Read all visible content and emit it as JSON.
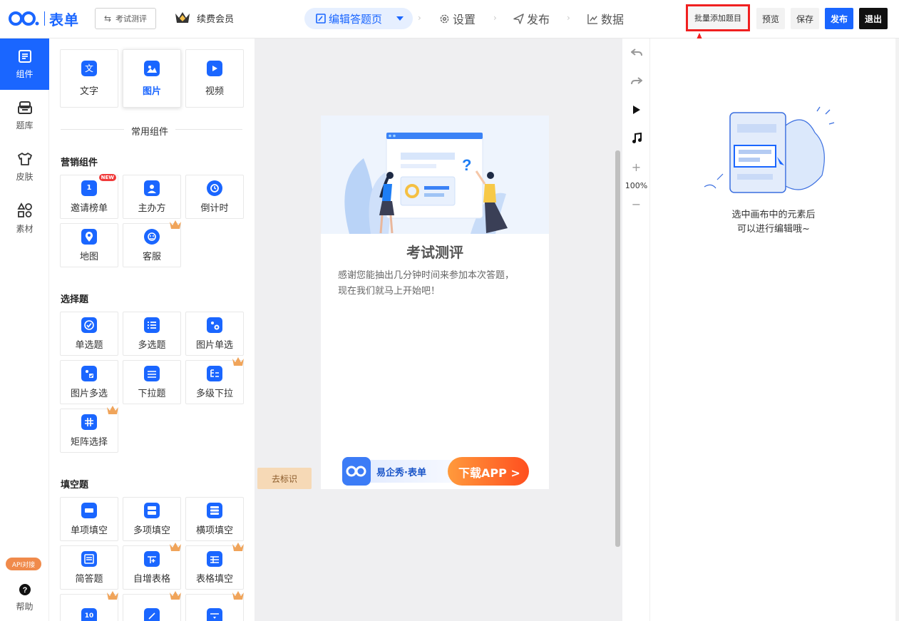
{
  "app": {
    "logo_text": "表单"
  },
  "header": {
    "form_title": "考试测评",
    "vip_label": "续费会员",
    "nav_active": "编辑答题页",
    "nav_settings": "设置",
    "nav_publish": "发布",
    "nav_data": "数据",
    "batch_add": "批量添加题目",
    "preview": "预览",
    "save": "保存",
    "publish_btn": "发布",
    "exit": "退出"
  },
  "rail": {
    "components": "组件",
    "bank": "题库",
    "skin": "皮肤",
    "material": "素材",
    "api_badge": "API对接",
    "help": "帮助"
  },
  "panel": {
    "basic": [
      "文字",
      "图片",
      "视频"
    ],
    "common_title": "常用组件",
    "marketing_title": "营销组件",
    "marketing": [
      "邀请榜单",
      "主办方",
      "倒计时",
      "地图",
      "客服"
    ],
    "new_badge": "NEW",
    "choice_title": "选择题",
    "choice": [
      "单选题",
      "多选题",
      "图片单选",
      "图片多选",
      "下拉题",
      "多级下拉",
      "矩阵选择"
    ],
    "fill_title": "填空题",
    "fill": [
      "单项填空",
      "多项填空",
      "横项填空",
      "简答题",
      "自增表格",
      "表格填空"
    ],
    "stepper_value": "10"
  },
  "canvas": {
    "title": "考试测评",
    "desc_line1": "感谢您能抽出几分钟时间来参加本次答题，",
    "desc_line2": "现在我们就马上开始吧！",
    "brand": "易企秀·表单",
    "download": "下载APP >",
    "tag_button": "去标识"
  },
  "tools": {
    "zoom": "100%",
    "plus": "+",
    "minus": "−"
  },
  "right": {
    "hint_line1": "选中画布中的元素后",
    "hint_line2": "可以进行编辑哦~"
  },
  "colors": {
    "accent": "#1a66ff",
    "highlight": "#f02020",
    "vip": "#f08a4b"
  }
}
